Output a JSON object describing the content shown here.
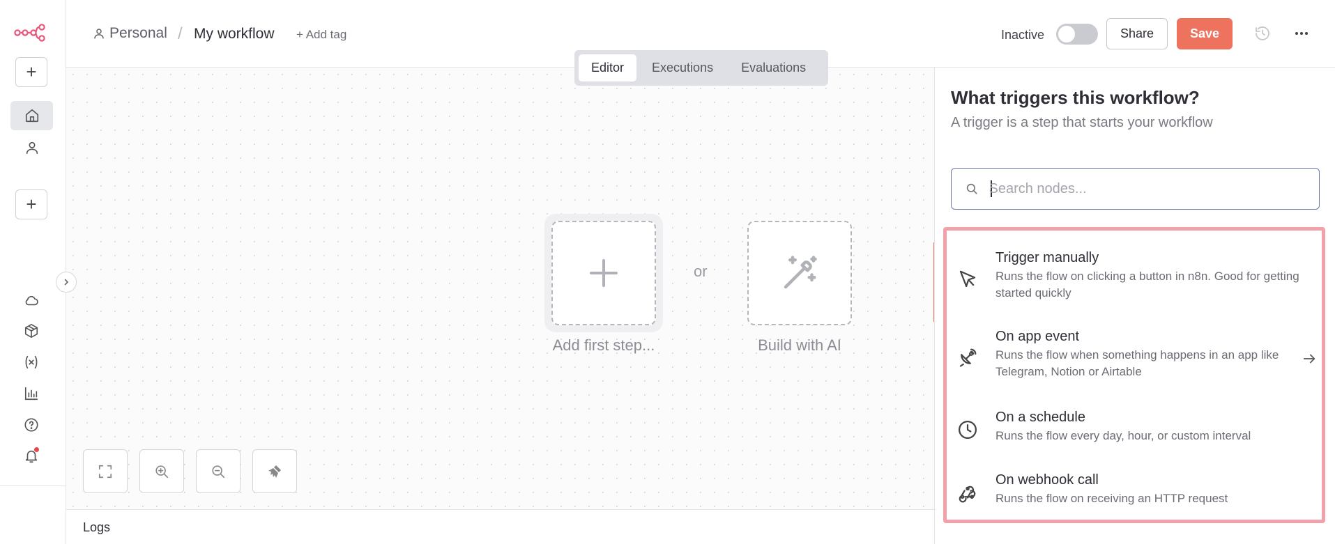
{
  "sidebar": {
    "logo": "n8n-logo",
    "add_label": "+",
    "create_label": "+"
  },
  "header": {
    "project": "Personal",
    "separator": "/",
    "workflow_name": "My workflow",
    "add_tag": "+ Add tag",
    "status_label": "Inactive",
    "share_label": "Share",
    "save_label": "Save"
  },
  "tabs": [
    {
      "label": "Editor",
      "active": true
    },
    {
      "label": "Executions",
      "active": false
    },
    {
      "label": "Evaluations",
      "active": false
    }
  ],
  "canvas": {
    "add_first_step": "Add first step...",
    "or_label": "or",
    "build_with_ai": "Build with AI"
  },
  "logs": {
    "label": "Logs"
  },
  "panel": {
    "title": "What triggers this workflow?",
    "subtitle": "A trigger is a step that starts your workflow",
    "search_placeholder": "Search nodes...",
    "items": [
      {
        "title": "Trigger manually",
        "desc": "Runs the flow on clicking a button in n8n. Good for getting started quickly",
        "icon": "cursor-icon"
      },
      {
        "title": "On app event",
        "desc": "Runs the flow when something happens in an app like Telegram, Notion or Airtable",
        "icon": "satellite-icon"
      },
      {
        "title": "On a schedule",
        "desc": "Runs the flow every day, hour, or custom interval",
        "icon": "clock-icon"
      },
      {
        "title": "On webhook call",
        "desc": "Runs the flow on receiving an HTTP request",
        "icon": "webhook-icon"
      }
    ]
  },
  "colors": {
    "accent": "#ee735f",
    "highlight": "#f1a1a7",
    "logo": "#e5587c"
  }
}
